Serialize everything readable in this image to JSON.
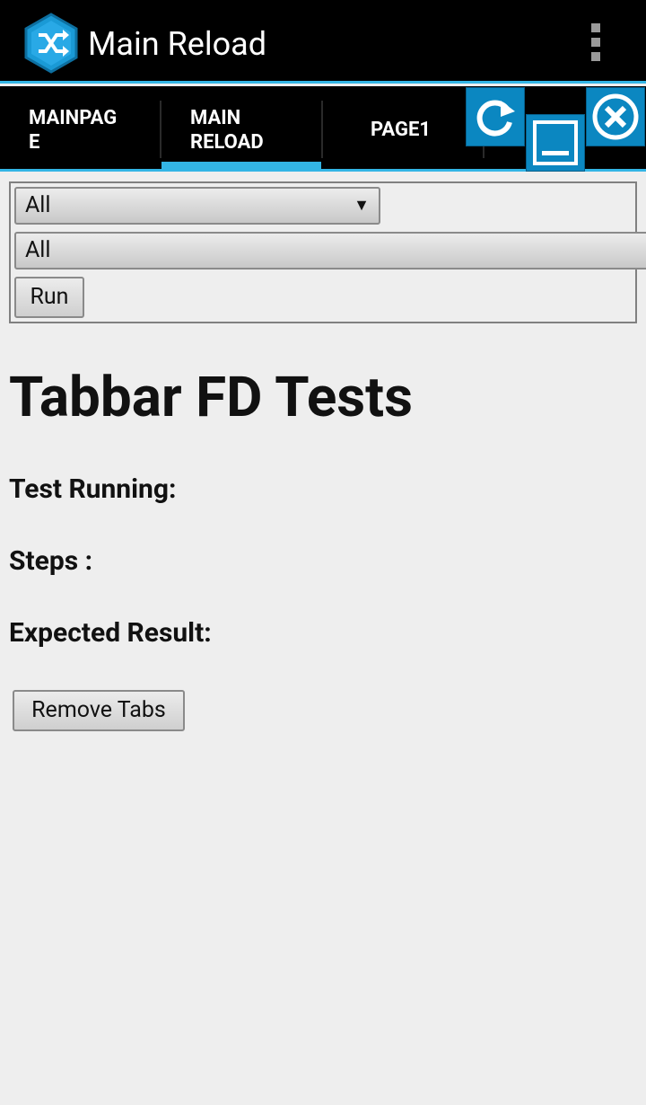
{
  "app": {
    "title": "Main Reload",
    "icon": "shuffle-app-icon",
    "overflow_icon": "overflow-menu-icon"
  },
  "tabs": [
    {
      "line1": "MAINPAG",
      "line2": "E",
      "selected": false
    },
    {
      "line1": "MAIN",
      "line2": "RELOAD",
      "selected": true
    },
    {
      "line1": "PAGE1",
      "line2": "",
      "selected": false
    }
  ],
  "tab_tools": {
    "reload_icon": "reload-icon",
    "minimize_icon": "minimize-icon",
    "close_icon": "close-icon"
  },
  "controls": {
    "select1_value": "All",
    "select2_value": "All",
    "run_label": "Run"
  },
  "main": {
    "heading": "Tabbar FD Tests",
    "test_running_label": "Test Running:",
    "steps_label": "Steps :",
    "expected_label": "Expected Result:",
    "remove_tabs_label": "Remove Tabs"
  },
  "colors": {
    "accent": "#33b5e5",
    "bar_bg": "#000000",
    "tool_blue": "#0b87c1",
    "page_bg": "#eeeeee"
  }
}
